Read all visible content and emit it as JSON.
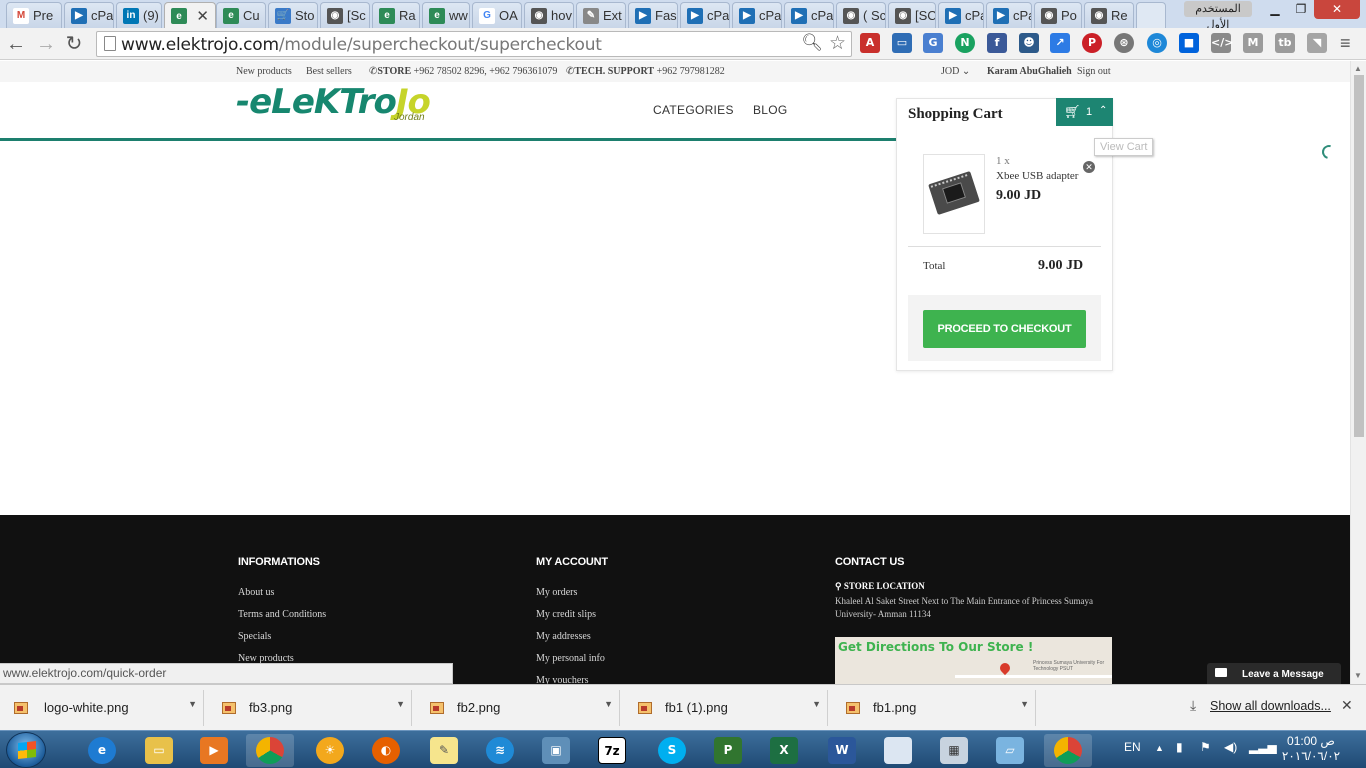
{
  "browser": {
    "tabs": [
      {
        "label": "Pre",
        "icon": "gmail-icon",
        "color": "#d44638"
      },
      {
        "label": "cPa",
        "icon": "cpanel-icon",
        "color": "#1f6fb5"
      },
      {
        "label": "(9)",
        "icon": "linkedin-icon",
        "color": "#0077b5"
      },
      {
        "label": "",
        "icon": "page-icon",
        "color": "#2e8b57",
        "active": true
      },
      {
        "label": "Cu",
        "icon": "page-icon",
        "color": "#2e8b57"
      },
      {
        "label": "Sto",
        "icon": "cart-icon",
        "color": "#3a7ac8"
      },
      {
        "label": "[Sc",
        "icon": "github-icon",
        "color": "#555555"
      },
      {
        "label": "Ra",
        "icon": "page-icon",
        "color": "#2e8b57"
      },
      {
        "label": "ww",
        "icon": "page-icon",
        "color": "#2e8b57"
      },
      {
        "label": "OA",
        "icon": "google-icon",
        "color": "#4285f4"
      },
      {
        "label": "hov",
        "icon": "github-icon",
        "color": "#555555"
      },
      {
        "label": "Ext",
        "icon": "wrench-icon",
        "color": "#666666"
      },
      {
        "label": "Fas",
        "icon": "cpanel-icon",
        "color": "#1f6fb5"
      },
      {
        "label": "cPa",
        "icon": "cpanel-icon",
        "color": "#1f6fb5"
      },
      {
        "label": "cPa",
        "icon": "cpanel-icon",
        "color": "#1f6fb5"
      },
      {
        "label": "cPa",
        "icon": "cpanel-icon",
        "color": "#1f6fb5"
      },
      {
        "label": "( Sc",
        "icon": "github-icon",
        "color": "#555555"
      },
      {
        "label": "[SC",
        "icon": "github-icon",
        "color": "#555555"
      },
      {
        "label": "cPa",
        "icon": "cpanel-icon",
        "color": "#1f6fb5"
      },
      {
        "label": "cPa",
        "icon": "cpanel-icon",
        "color": "#1f6fb5"
      },
      {
        "label": "Po",
        "icon": "github-icon",
        "color": "#555555"
      },
      {
        "label": "Re",
        "icon": "github-icon",
        "color": "#555555"
      }
    ],
    "window_title": "المستخدم الأول",
    "url_host": "www.elektrojo.com",
    "url_path": "/module/supercheckout/supercheckout",
    "status_url": "www.elektrojo.com/quick-order"
  },
  "site": {
    "topbar": {
      "new_products": "New products",
      "best_sellers": "Best sellers",
      "store": "STORE",
      "store_phones": "+962 78502 8296, +962 796361079",
      "tech_support": "TECH. SUPPORT",
      "tech_phone": "+962 797981282",
      "currency": "JOD",
      "user_name": "Karam AbuGhalieh",
      "sign_out": "Sign out"
    },
    "logo": {
      "word_main": "-eLeKTro",
      "word_tail": "Jo",
      "country": "Jordan"
    },
    "nav": {
      "categories": "CATEGORIES",
      "blog": "BLOG"
    }
  },
  "cart": {
    "title": "Shopping Cart",
    "count": "1",
    "tooltip": "View Cart",
    "item": {
      "qty": "1 x",
      "name": "Xbee USB adapter",
      "price": "9.00 JD"
    },
    "total_label": "Total",
    "total_value": "9.00 JD",
    "checkout_label": "PROCEED TO CHECKOUT"
  },
  "footer": {
    "informations": {
      "title": "INFORMATIONS",
      "links": [
        "About us",
        "Terms and Conditions",
        "Specials",
        "New products"
      ]
    },
    "account": {
      "title": "MY ACCOUNT",
      "links": [
        "My orders",
        "My credit slips",
        "My addresses",
        "My personal info",
        "My vouchers"
      ]
    },
    "contact": {
      "title": "CONTACT US",
      "location_title": "STORE LOCATION",
      "address": "Khaleel Al Saket Street Next to The Main Entrance of Princess Sumaya University- Amman 11134",
      "map_title": "Get Directions To Our Store !",
      "map_note": "Princess Sumaya University For Technology PSUT"
    },
    "leave_message": "Leave a Message"
  },
  "downloads": {
    "files": [
      "logo-white.png",
      "fb3.png",
      "fb2.png",
      "fb1 (1).png",
      "fb1.png"
    ],
    "show_all": "Show all downloads..."
  },
  "taskbar": {
    "lang": "EN",
    "time": "01:00 ص",
    "date": "٢٠١٦/٠٦/٠٢"
  },
  "colors": {
    "brand_green": "#1d8572",
    "checkout_green": "#3eb34f",
    "logo_lime": "#c6d42a",
    "footer_bg": "#111111"
  }
}
